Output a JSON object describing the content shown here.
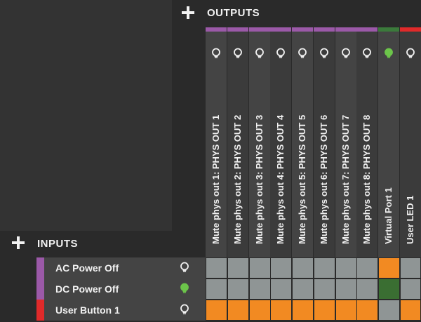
{
  "outputs_header": {
    "label": "OUTPUTS"
  },
  "inputs_header": {
    "label": "INPUTS"
  },
  "colors": {
    "purple": "#9b59a8",
    "green": "#3b7a3b",
    "red": "#e02a2a",
    "orange": "#f28a22",
    "gray": "#8f9595",
    "dark_green": "#3a6e32",
    "bulb_on": "#6cc54a",
    "bulb_off": "#f2f2f2"
  },
  "outputs": [
    {
      "label": "Mute phys out 1: PHYS OUT 1",
      "group_color": "purple",
      "lit": false
    },
    {
      "label": "Mute phys out 2: PHYS OUT 2",
      "group_color": "purple",
      "lit": false
    },
    {
      "label": "Mute phys out 3: PHYS OUT 3",
      "group_color": "purple",
      "lit": false
    },
    {
      "label": "Mute phys out 4: PHYS OUT 4",
      "group_color": "purple",
      "lit": false
    },
    {
      "label": "Mute phys out 5: PHYS OUT 5",
      "group_color": "purple",
      "lit": false
    },
    {
      "label": "Mute phys out 6: PHYS OUT 6",
      "group_color": "purple",
      "lit": false
    },
    {
      "label": "Mute phys out 7: PHYS OUT 7",
      "group_color": "purple",
      "lit": false
    },
    {
      "label": "Mute phys out 8: PHYS OUT 8",
      "group_color": "purple",
      "lit": false
    },
    {
      "label": "Virtual Port 1",
      "group_color": "green",
      "lit": true
    },
    {
      "label": "User LED 1",
      "group_color": "red",
      "lit": false
    }
  ],
  "inputs": [
    {
      "label": "AC Power Off",
      "group_color": "purple",
      "lit": false
    },
    {
      "label": "DC Power Off",
      "group_color": "purple",
      "lit": true
    },
    {
      "label": "User Button 1",
      "group_color": "red",
      "lit": false
    }
  ],
  "matrix": [
    [
      "gray",
      "gray",
      "gray",
      "gray",
      "gray",
      "gray",
      "gray",
      "gray",
      "orange",
      "gray"
    ],
    [
      "gray",
      "gray",
      "gray",
      "gray",
      "gray",
      "gray",
      "gray",
      "gray",
      "dark_green",
      "gray"
    ],
    [
      "orange",
      "orange",
      "orange",
      "orange",
      "orange",
      "orange",
      "orange",
      "orange",
      "gray",
      "orange"
    ]
  ]
}
